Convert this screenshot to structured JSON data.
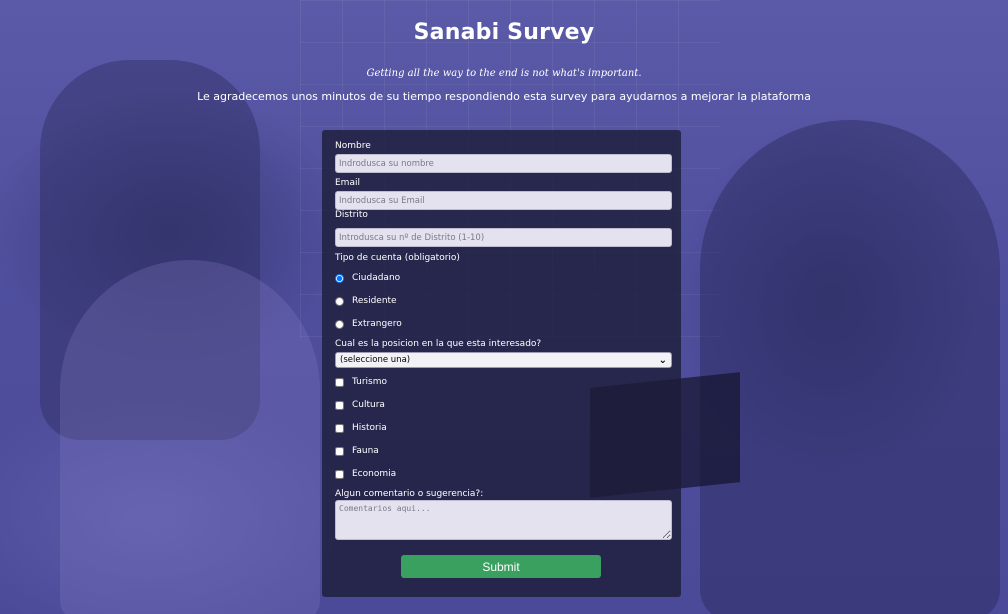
{
  "header": {
    "title": "Sanabi Survey",
    "tagline": "Getting all the way to the end is not what's important.",
    "description": "Le agradecemos unos minutos de su tiempo respondiendo esta survey para ayudarnos a mejorar la plataforma"
  },
  "form": {
    "name": {
      "label": "Nombre",
      "placeholder": "Indrodusca su nombre",
      "value": ""
    },
    "email": {
      "label": "Email",
      "placeholder": "Indrodusca su Email",
      "value": ""
    },
    "district": {
      "label": "Distrito",
      "placeholder": "Introdusca su nº de Distrito (1-10)",
      "value": ""
    },
    "account_type": {
      "label": "Tipo de cuenta (obligatorio)",
      "options": [
        "Ciudadano",
        "Residente",
        "Extrangero"
      ],
      "selected": "Ciudadano"
    },
    "position": {
      "label": "Cual es la posicion en la que esta interesado?",
      "selected": "(seleccione una)"
    },
    "interests": [
      "Turismo",
      "Cultura",
      "Historia",
      "Fauna",
      "Economia"
    ],
    "comments": {
      "label": "Algun comentario o sugerencia?:",
      "placeholder": "Comentarios aqui..."
    },
    "submit_label": "Submit"
  },
  "colors": {
    "accent": "#3aa060",
    "overlay": "#4d4d9c",
    "form_bg": "#1c1c37"
  }
}
